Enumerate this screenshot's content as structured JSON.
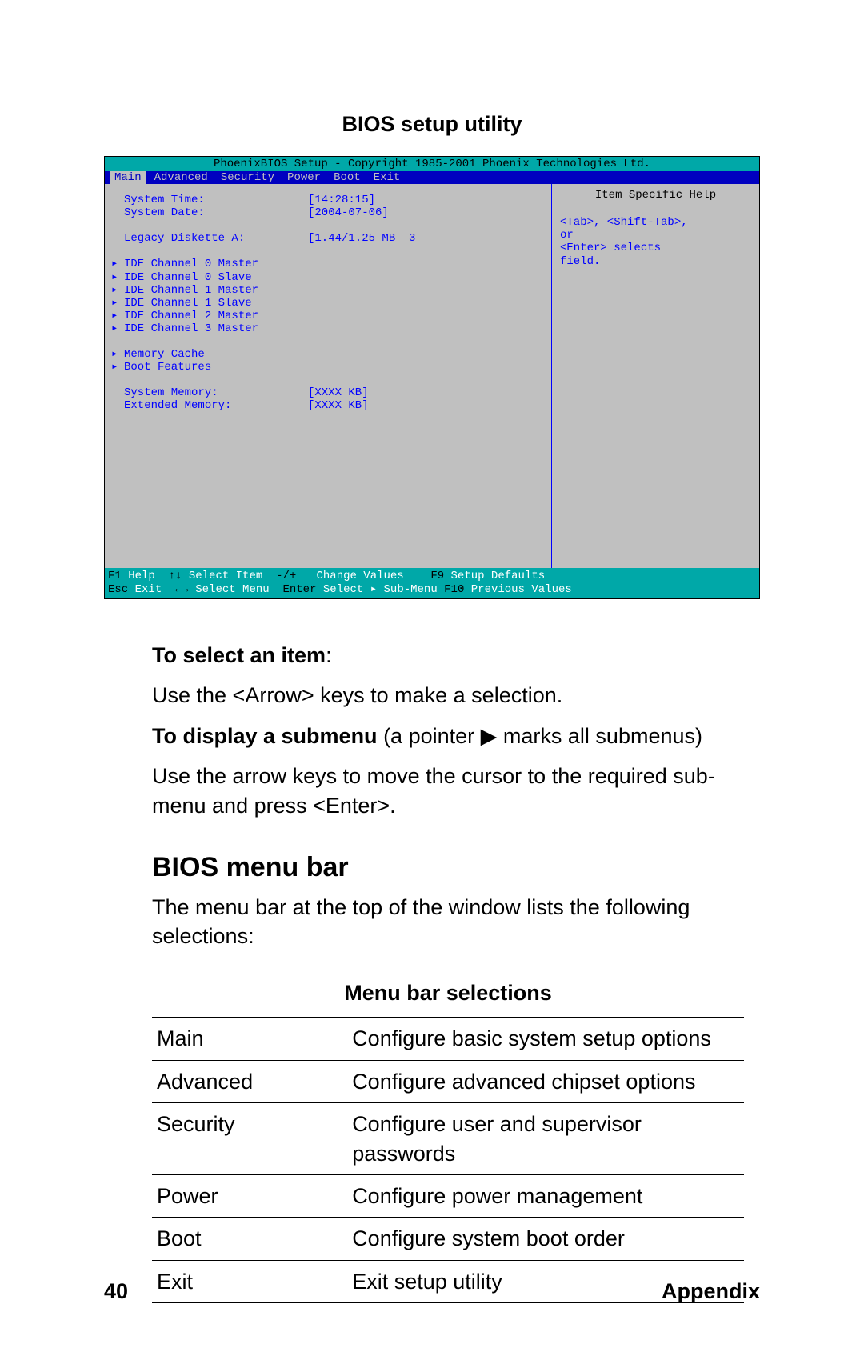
{
  "page_title": "BIOS setup utility",
  "bios": {
    "titlebar": "PhoenixBIOS Setup - Copyright 1985-2001 Phoenix Technologies Ltd.",
    "menus": [
      "Main",
      "Advanced",
      "Security",
      "Power",
      "Boot",
      "Exit"
    ],
    "selected_menu_index": 0,
    "rows": {
      "system_time_label": "System Time:",
      "system_time_value": "[14:28:15]",
      "system_date_label": "System Date:",
      "system_date_value": "[2004-07-06]",
      "legacy_label": "Legacy Diskette A:",
      "legacy_value": "[1.44/1.25 MB  3",
      "ide0m": "IDE Channel 0 Master",
      "ide0s": "IDE Channel 0 Slave",
      "ide1m": "IDE Channel 1 Master",
      "ide1s": "IDE Channel 1 Slave",
      "ide2m": "IDE Channel 2 Master",
      "ide3m": "IDE Channel 3 Master",
      "memcache": "Memory Cache",
      "bootfeat": "Boot Features",
      "sysmem_label": "System Memory:",
      "sysmem_value": "[XXXX KB]",
      "extmem_label": "Extended Memory:",
      "extmem_value": "[XXXX KB]"
    },
    "help": {
      "title": "Item Specific Help",
      "line1": "<Tab>, <Shift-Tab>,",
      "line2": "or",
      "line3": "<Enter> selects",
      "line4": "field."
    },
    "footer": {
      "l1a": "F1",
      "l1b": " Help  ",
      "l1c": "↑↓",
      "l1d": " Select Item  ",
      "l1e": "-/+",
      "l1f": "   Change Values    ",
      "l1g": "F9",
      "l1h": " Setup Defaults",
      "l2a": "Esc",
      "l2b": " Exit  ",
      "l2c": "←→",
      "l2d": " Select Menu  ",
      "l2e": "Enter",
      "l2f": " Select ▸ Sub-Menu ",
      "l2g": "F10",
      "l2h": " Previous Values"
    }
  },
  "instructions": {
    "select_heading": "To select an item",
    "select_body": "Use the <Arrow> keys to make a selection.",
    "submenu_heading": "To display a submenu",
    "submenu_tail": " (a pointer ",
    "submenu_tail2": " marks all submenus)",
    "submenu_body": "Use the arrow keys to move the cursor to the required sub-menu and press <Enter>."
  },
  "section_heading": "BIOS menu bar",
  "section_body": "The menu bar at the top of the window lists the following selections:",
  "table_title": "Menu bar selections",
  "table_rows": [
    {
      "c1": "Main",
      "c2": "Configure basic system setup options"
    },
    {
      "c1": "Advanced",
      "c2": "Configure advanced chipset options"
    },
    {
      "c1": "Security",
      "c2": "Configure user and supervisor passwords"
    },
    {
      "c1": "Power",
      "c2": "Configure power management"
    },
    {
      "c1": "Boot",
      "c2": "Configure system boot order"
    },
    {
      "c1": "Exit",
      "c2": "Exit setup utility"
    }
  ],
  "footer": {
    "page": "40",
    "section": "Appendix"
  }
}
